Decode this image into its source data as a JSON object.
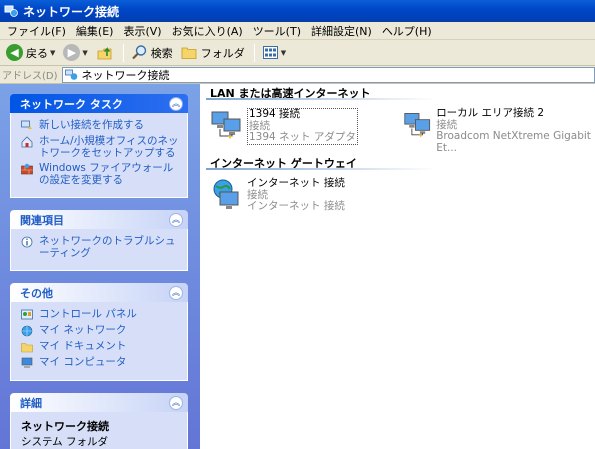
{
  "window": {
    "title": "ネットワーク接続"
  },
  "menu": [
    "ファイル(F)",
    "編集(E)",
    "表示(V)",
    "お気に入り(A)",
    "ツール(T)",
    "詳細設定(N)",
    "ヘルプ(H)"
  ],
  "toolbar": {
    "back_label": "戻る",
    "search_label": "検索",
    "folders_label": "フォルダ"
  },
  "address": {
    "label": "アドレス(D)",
    "value": "ネットワーク接続"
  },
  "taskpane": {
    "network_tasks": {
      "title": "ネットワーク タスク",
      "items": [
        {
          "label": "新しい接続を作成する",
          "icon": "new-connection-icon"
        },
        {
          "label": "ホーム/小規模オフィスのネットワークをセットアップする",
          "icon": "home-network-icon"
        },
        {
          "label": "Windows ファイアウォールの設定を変更する",
          "icon": "firewall-icon"
        }
      ]
    },
    "related": {
      "title": "関連項目",
      "items": [
        {
          "label": "ネットワークのトラブルシューティング",
          "icon": "info-icon"
        }
      ]
    },
    "other": {
      "title": "その他",
      "items": [
        {
          "label": "コントロール パネル",
          "icon": "control-panel-icon"
        },
        {
          "label": "マイ ネットワーク",
          "icon": "my-network-icon"
        },
        {
          "label": "マイ ドキュメント",
          "icon": "my-documents-icon"
        },
        {
          "label": "マイ コンピュータ",
          "icon": "my-computer-icon"
        }
      ]
    },
    "details": {
      "title": "詳細",
      "name": "ネットワーク接続",
      "type": "システム フォルダ"
    }
  },
  "groups": {
    "lan": {
      "title": "LAN または高速インターネット",
      "items": [
        {
          "name": "1394 接続",
          "status": "接続",
          "device": "1394 ネット アダプタ"
        },
        {
          "name": "ローカル エリア接続 2",
          "status": "接続",
          "device": "Broadcom NetXtreme Gigabit Et..."
        }
      ]
    },
    "gateway": {
      "title": "インターネット ゲートウェイ",
      "items": [
        {
          "name": "インターネット 接続",
          "status": "接続",
          "device": "インターネット 接続"
        }
      ]
    }
  },
  "colors": {
    "titlebar": "#0047c8",
    "taskpane": "#6f8fdf",
    "link": "#215dc6",
    "chrome": "#ece9d8"
  }
}
